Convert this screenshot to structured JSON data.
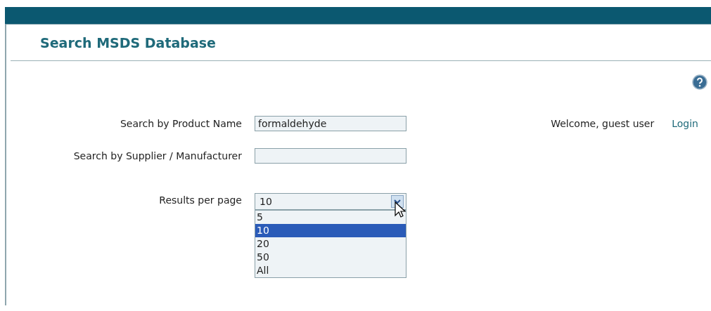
{
  "page": {
    "title": "Search MSDS Database"
  },
  "fields": [
    {
      "label": "Search by Product Name",
      "value": "formaldehyde"
    },
    {
      "label": "Search by Supplier / Manufacturer"
    }
  ],
  "results_per_page": {
    "label": "Results per page",
    "value": "10",
    "expanded": true,
    "options": [
      {
        "label": "5",
        "selected": false
      },
      {
        "label": "10",
        "selected": true
      },
      {
        "label": "20",
        "selected": false
      },
      {
        "label": "50",
        "selected": false
      },
      {
        "label": "All",
        "selected": false
      }
    ]
  },
  "user": {
    "welcome": "Welcome, guest user",
    "login": "Login"
  }
}
